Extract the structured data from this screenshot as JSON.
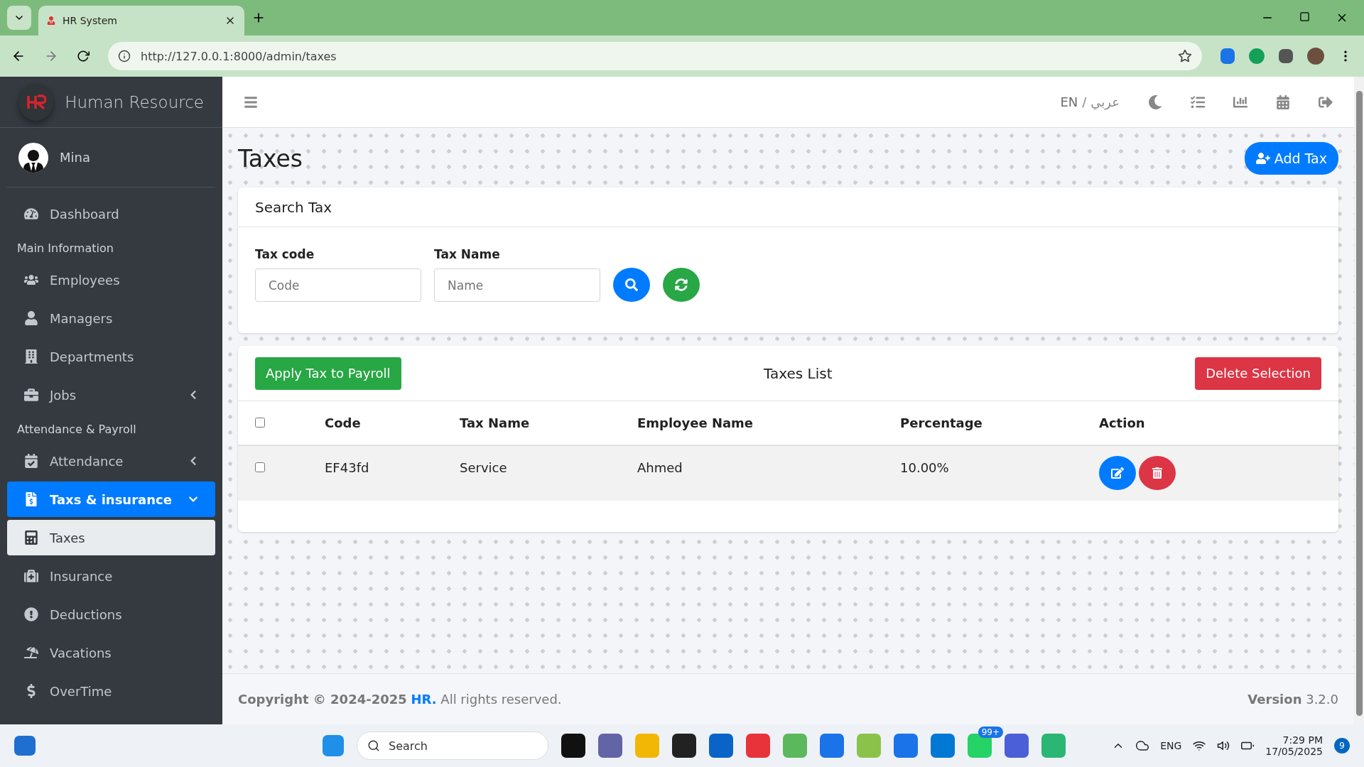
{
  "browser": {
    "tab_title": "HR System",
    "url": "http://127.0.0.1:8000/admin/taxes"
  },
  "sidebar": {
    "brand": "Human Resource",
    "user": "Mina",
    "items": [
      {
        "kind": "link",
        "label": "Dashboard",
        "selected": false
      },
      {
        "kind": "heading",
        "label": "Main Information"
      },
      {
        "kind": "link",
        "label": "Employees",
        "selected": false
      },
      {
        "kind": "link",
        "label": "Managers",
        "selected": false
      },
      {
        "kind": "link",
        "label": "Departments",
        "selected": false
      },
      {
        "kind": "group",
        "label": "Jobs",
        "selected": false,
        "expanded": false
      },
      {
        "kind": "heading",
        "label": "Attendance & Payroll"
      },
      {
        "kind": "group",
        "label": "Attendance",
        "selected": false,
        "expanded": false
      },
      {
        "kind": "group",
        "label": "Taxs & insurance",
        "selected": true,
        "expanded": true
      },
      {
        "kind": "sublink",
        "label": "Taxes",
        "selected": true
      },
      {
        "kind": "link",
        "label": "Insurance",
        "selected": false
      },
      {
        "kind": "link",
        "label": "Deductions",
        "selected": false
      },
      {
        "kind": "link",
        "label": "Vacations",
        "selected": false
      },
      {
        "kind": "link",
        "label": "OverTime",
        "selected": false
      }
    ]
  },
  "topbar": {
    "languages": [
      {
        "label": "EN",
        "selected": true
      },
      {
        "label": "عربي",
        "selected": false
      }
    ],
    "separator": "/"
  },
  "page": {
    "title": "Taxes",
    "add_button": "Add Tax"
  },
  "search": {
    "title": "Search Tax",
    "fields": [
      {
        "label": "Tax code",
        "placeholder": "Code"
      },
      {
        "label": "Tax Name",
        "placeholder": "Name"
      }
    ]
  },
  "list": {
    "title": "Taxes List",
    "apply_button": "Apply Tax to Payroll",
    "delete_button": "Delete Selection",
    "select_all_checked": false,
    "columns": [
      "Code",
      "Tax Name",
      "Employee Name",
      "Percentage",
      "Action"
    ],
    "rows": [
      {
        "checked": false,
        "cells": [
          "EF43fd",
          "Service",
          "Ahmed",
          "10.00%"
        ]
      }
    ]
  },
  "footer": {
    "copyright_prefix": "Copyright © 2024-2025",
    "copyright_link": "HR.",
    "copyright_suffix": "All rights reserved.",
    "version": "**Version** 3.2.0"
  },
  "taskbar": {
    "search_placeholder": "Search",
    "badge": "99+",
    "language": "ENG",
    "time": "7:29 PM",
    "date": "17/05/2025",
    "notifications": "9"
  }
}
